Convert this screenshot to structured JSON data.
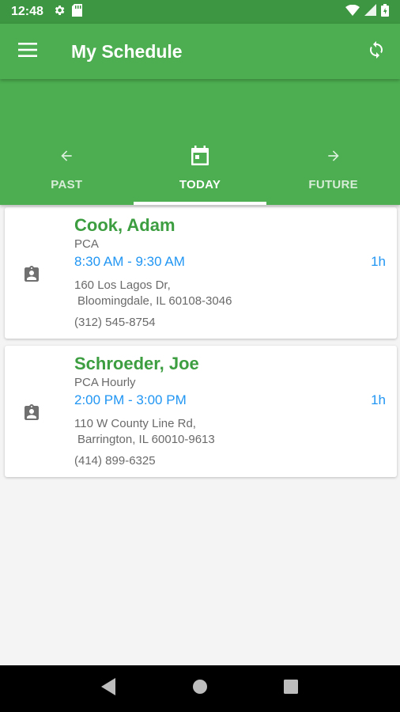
{
  "status_bar": {
    "time": "12:48"
  },
  "app_bar": {
    "title": "My Schedule"
  },
  "tabs": [
    {
      "label": "PAST",
      "icon": "arrow-left-icon",
      "active": false
    },
    {
      "label": "TODAY",
      "icon": "calendar-icon",
      "active": true
    },
    {
      "label": "FUTURE",
      "icon": "arrow-right-icon",
      "active": false
    }
  ],
  "appointments": [
    {
      "name": "Cook, Adam",
      "role": "PCA",
      "time": "8:30 AM - 9:30 AM",
      "duration": "1h",
      "address_line1": "160 Los Lagos Dr,",
      "address_line2": "Bloomingdale, IL 60108-3046",
      "phone": "(312) 545-8754"
    },
    {
      "name": "Schroeder, Joe",
      "role": "PCA Hourly",
      "time": "2:00 PM - 3:00 PM",
      "duration": "1h",
      "address_line1": "110 W County Line Rd,",
      "address_line2": "Barrington, IL 60010-9613",
      "phone": "(414) 899-6325"
    }
  ],
  "colors": {
    "primary": "#4cae50",
    "primary_dark": "#3d9641",
    "name_green": "#3c9e40",
    "time_blue": "#2196f3"
  }
}
